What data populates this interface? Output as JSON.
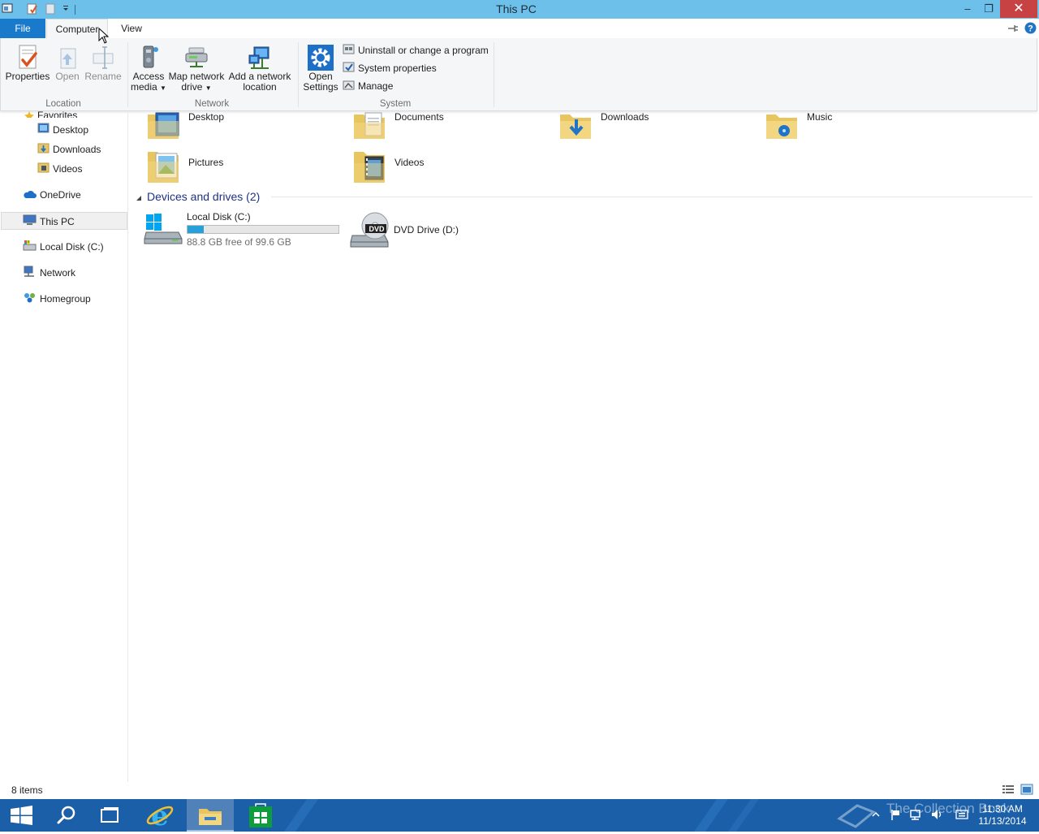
{
  "window": {
    "title": "This PC",
    "minimize_glyph": "–",
    "restore_glyph": "❐",
    "close_glyph": "✕"
  },
  "ribbon_tabs": {
    "file": "File",
    "computer": "Computer",
    "view": "View"
  },
  "ribbon": {
    "location": {
      "group_label": "Location",
      "properties": "Properties",
      "open": "Open",
      "rename": "Rename"
    },
    "network": {
      "group_label": "Network",
      "access_media_1": "Access",
      "access_media_2": "media",
      "map_network_drive_1": "Map network",
      "map_network_drive_2": "drive",
      "add_network_location_1": "Add a network",
      "add_network_location_2": "location"
    },
    "system": {
      "group_label": "System",
      "open_settings_1": "Open",
      "open_settings_2": "Settings",
      "uninstall": "Uninstall or change a program",
      "system_properties": "System properties",
      "manage": "Manage"
    }
  },
  "nav_pane": {
    "favorites": "Favorites",
    "desktop": "Desktop",
    "downloads": "Downloads",
    "videos": "Videos",
    "onedrive": "OneDrive",
    "this_pc": "This PC",
    "local_disk": "Local Disk (C:)",
    "network": "Network",
    "homegroup": "Homegroup"
  },
  "folders": {
    "desktop": "Desktop",
    "documents": "Documents",
    "downloads": "Downloads",
    "music": "Music",
    "pictures": "Pictures",
    "videos": "Videos"
  },
  "devices": {
    "group_header": "Devices and drives (2)",
    "local_disk": {
      "name": "Local Disk (C:)",
      "free_text": "88.8 GB free of 99.6 GB",
      "used_fraction": 0.108
    },
    "dvd_drive": {
      "name": "DVD Drive (D:)",
      "badge": "DVD"
    }
  },
  "status_bar": {
    "item_count": "8 items"
  },
  "taskbar": {
    "time": "11:30 AM",
    "date": "11/13/2014",
    "watermark": "The Collection Book"
  },
  "colors": {
    "titlebar": "#6cc0ea",
    "file_tab": "#1979ca",
    "taskbar": "#1b5fa8",
    "drive_bar_fill": "#26a0da"
  }
}
